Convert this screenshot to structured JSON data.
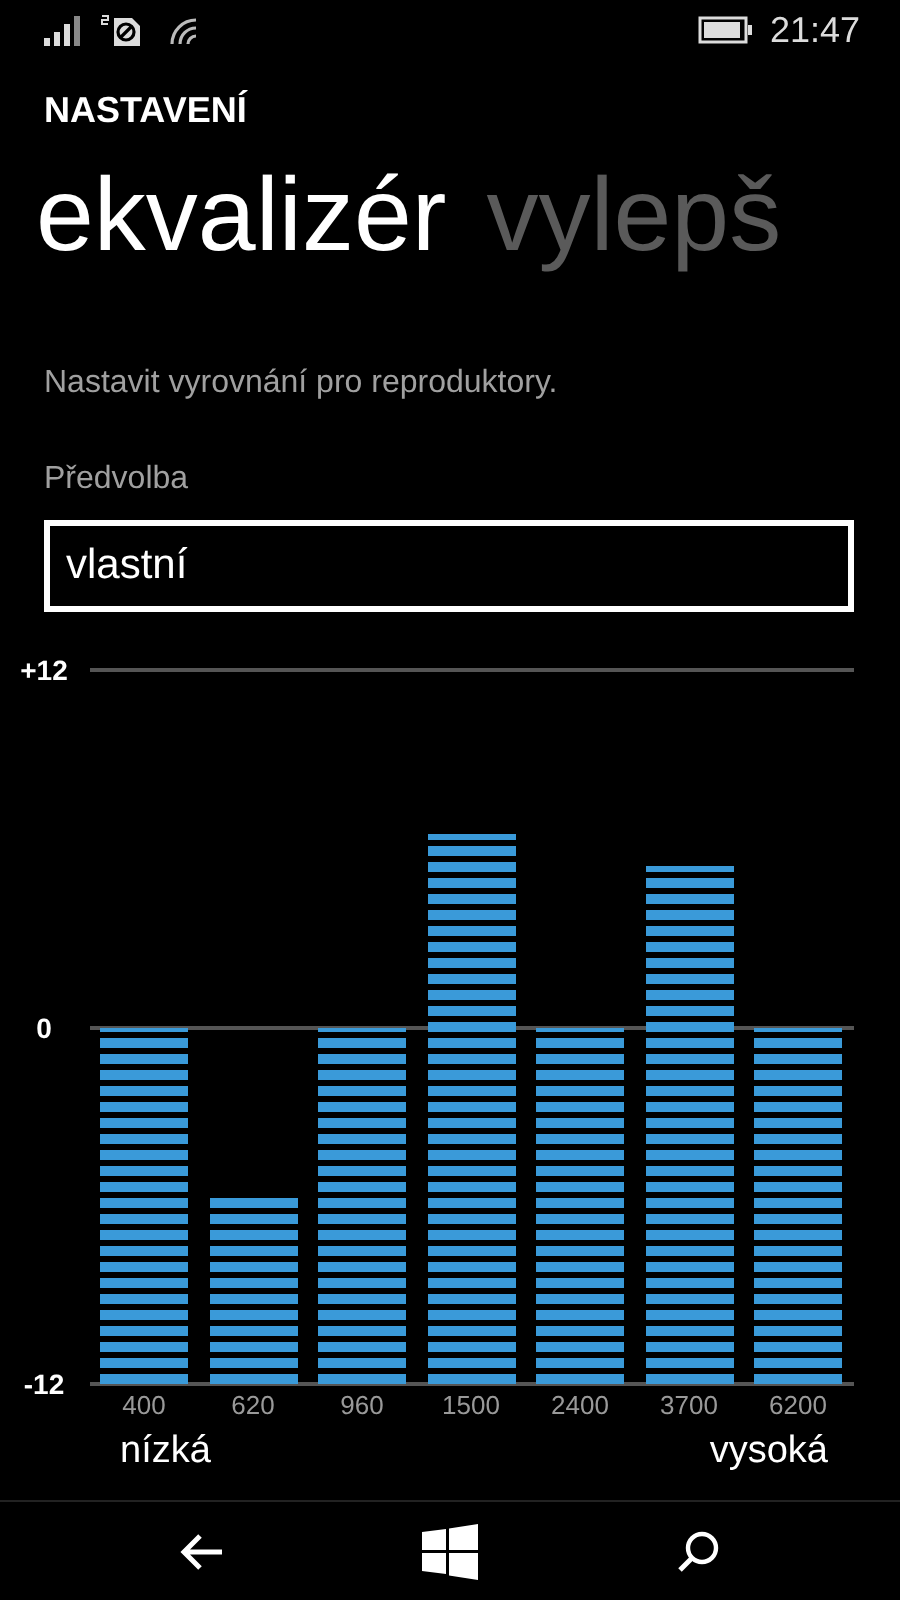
{
  "status_bar": {
    "time": "21:47"
  },
  "app_title": "NASTAVENÍ",
  "pivots": [
    {
      "label": "ekvalizér",
      "selected": true
    },
    {
      "label": "vylepš",
      "selected": false
    }
  ],
  "description": "Nastavit vyrovnání pro reproduktory.",
  "preset": {
    "label": "Předvolba",
    "value": "vlastní"
  },
  "equalizer": {
    "scale_labels": [
      "+12",
      "0",
      "-12"
    ],
    "bands": [
      {
        "frequency": "400",
        "level": 0.5
      },
      {
        "frequency": "620",
        "level": 0.26
      },
      {
        "frequency": "960",
        "level": 0.5
      },
      {
        "frequency": "1500",
        "level": 0.77
      },
      {
        "frequency": "2400",
        "level": 0.5
      },
      {
        "frequency": "3700",
        "level": 0.725
      },
      {
        "frequency": "6200",
        "level": 0.5
      }
    ],
    "low_label": "nízká",
    "high_label": "vysoká"
  }
}
